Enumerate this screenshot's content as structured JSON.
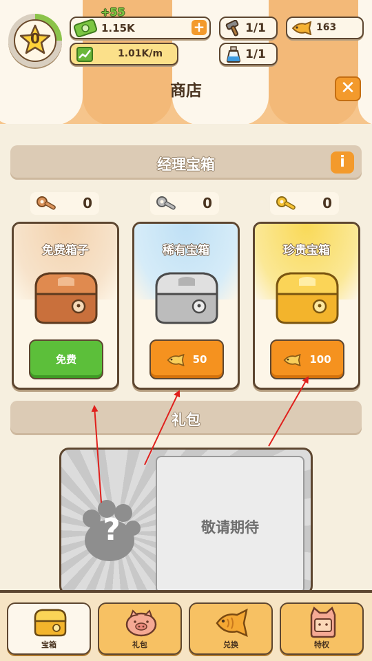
{
  "header": {
    "level": "0",
    "currency": {
      "value": "1.15K",
      "gain": "+55",
      "rate": "1.01K/m"
    },
    "hammer": "1/1",
    "potion": "1/1",
    "fish": "163",
    "title": "商店"
  },
  "manager_chest": {
    "title": "经理宝箱",
    "keys": [
      "0",
      "0",
      "0"
    ],
    "chests": [
      {
        "name": "免费箱子",
        "button": "免费",
        "color": "#f5d9b8"
      },
      {
        "name": "稀有宝箱",
        "button": "50",
        "color": "#cfe6f5"
      },
      {
        "name": "珍贵宝箱",
        "button": "100",
        "color": "#fbe38a"
      }
    ]
  },
  "gift": {
    "title": "礼包",
    "placeholder": "敬请期待",
    "mystery": "?"
  },
  "nav": [
    {
      "label": "宝箱",
      "active": true
    },
    {
      "label": "礼包",
      "active": false
    },
    {
      "label": "兑换",
      "active": false
    },
    {
      "label": "特权",
      "active": false
    }
  ],
  "colors": {
    "accent": "#f39a2c",
    "green": "#5cbf3a",
    "outline": "#5d4630"
  }
}
